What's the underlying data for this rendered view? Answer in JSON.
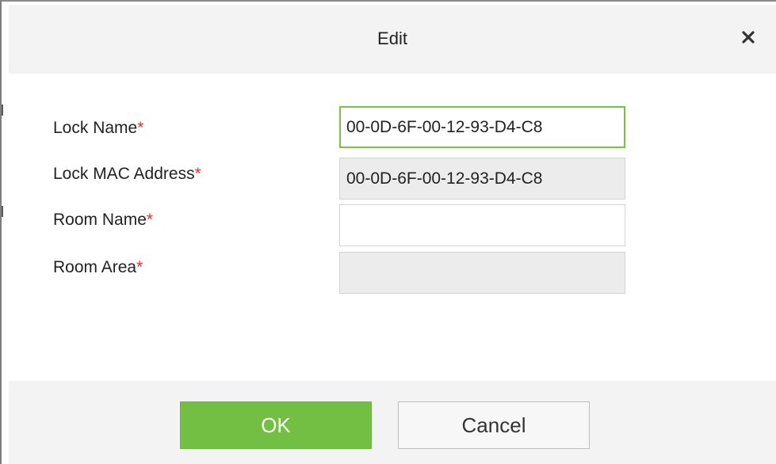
{
  "dialog": {
    "title": "Edit",
    "close_icon": "close-icon"
  },
  "form": {
    "lock_name": {
      "label": "Lock Name",
      "required_mark": "*",
      "value": "00-0D-6F-00-12-93-D4-C8"
    },
    "lock_mac": {
      "label": "Lock MAC Address",
      "required_mark": "*",
      "value": "00-0D-6F-00-12-93-D4-C8"
    },
    "room_name": {
      "label": "Room Name",
      "required_mark": "*",
      "value": ""
    },
    "room_area": {
      "label": "Room Area",
      "required_mark": "*",
      "value": ""
    }
  },
  "footer": {
    "ok_label": "OK",
    "cancel_label": "Cancel"
  },
  "colors": {
    "accent": "#72bf44",
    "focus_border": "#7ac143",
    "required": "#e0312b"
  }
}
